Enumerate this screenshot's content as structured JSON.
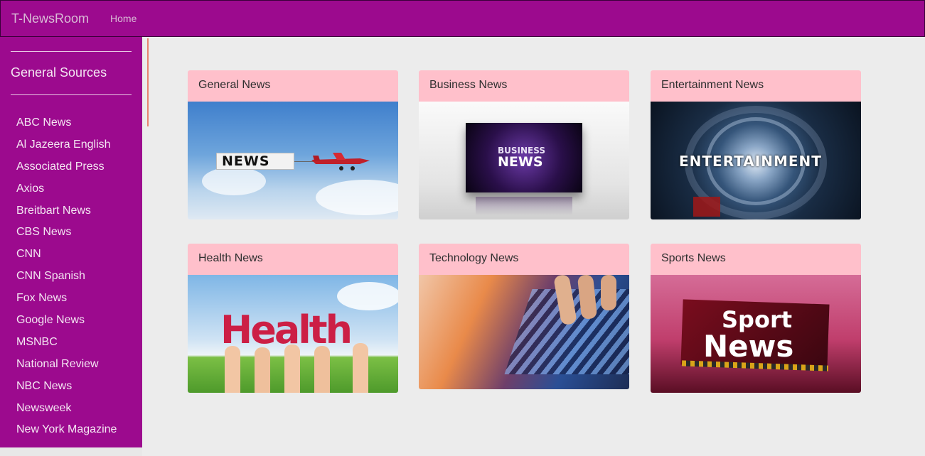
{
  "navbar": {
    "brand": "T-NewsRoom",
    "home": "Home"
  },
  "sidebar": {
    "title": "General Sources",
    "items": [
      "ABC News",
      "Al Jazeera English",
      "Associated Press",
      "Axios",
      "Breitbart News",
      "CBS News",
      "CNN",
      "CNN Spanish",
      "Fox News",
      "Google News",
      "MSNBC",
      "National Review",
      "NBC News",
      "Newsweek",
      "New York Magazine"
    ]
  },
  "cards": [
    {
      "title": "General News",
      "image_text": "NEWS"
    },
    {
      "title": "Business News",
      "image_text_1": "BUSINESS",
      "image_text_2": "NEWS"
    },
    {
      "title": "Entertainment News",
      "image_text": "ENTERTAINMENT"
    },
    {
      "title": "Health News",
      "image_text": "Health"
    },
    {
      "title": "Technology News"
    },
    {
      "title": "Sports News",
      "image_text_1": "Sport",
      "image_text_2": "News"
    }
  ],
  "colors": {
    "navbar": "#9c0a8e",
    "card_header": "#ffc0cb",
    "background": "#ececec"
  }
}
